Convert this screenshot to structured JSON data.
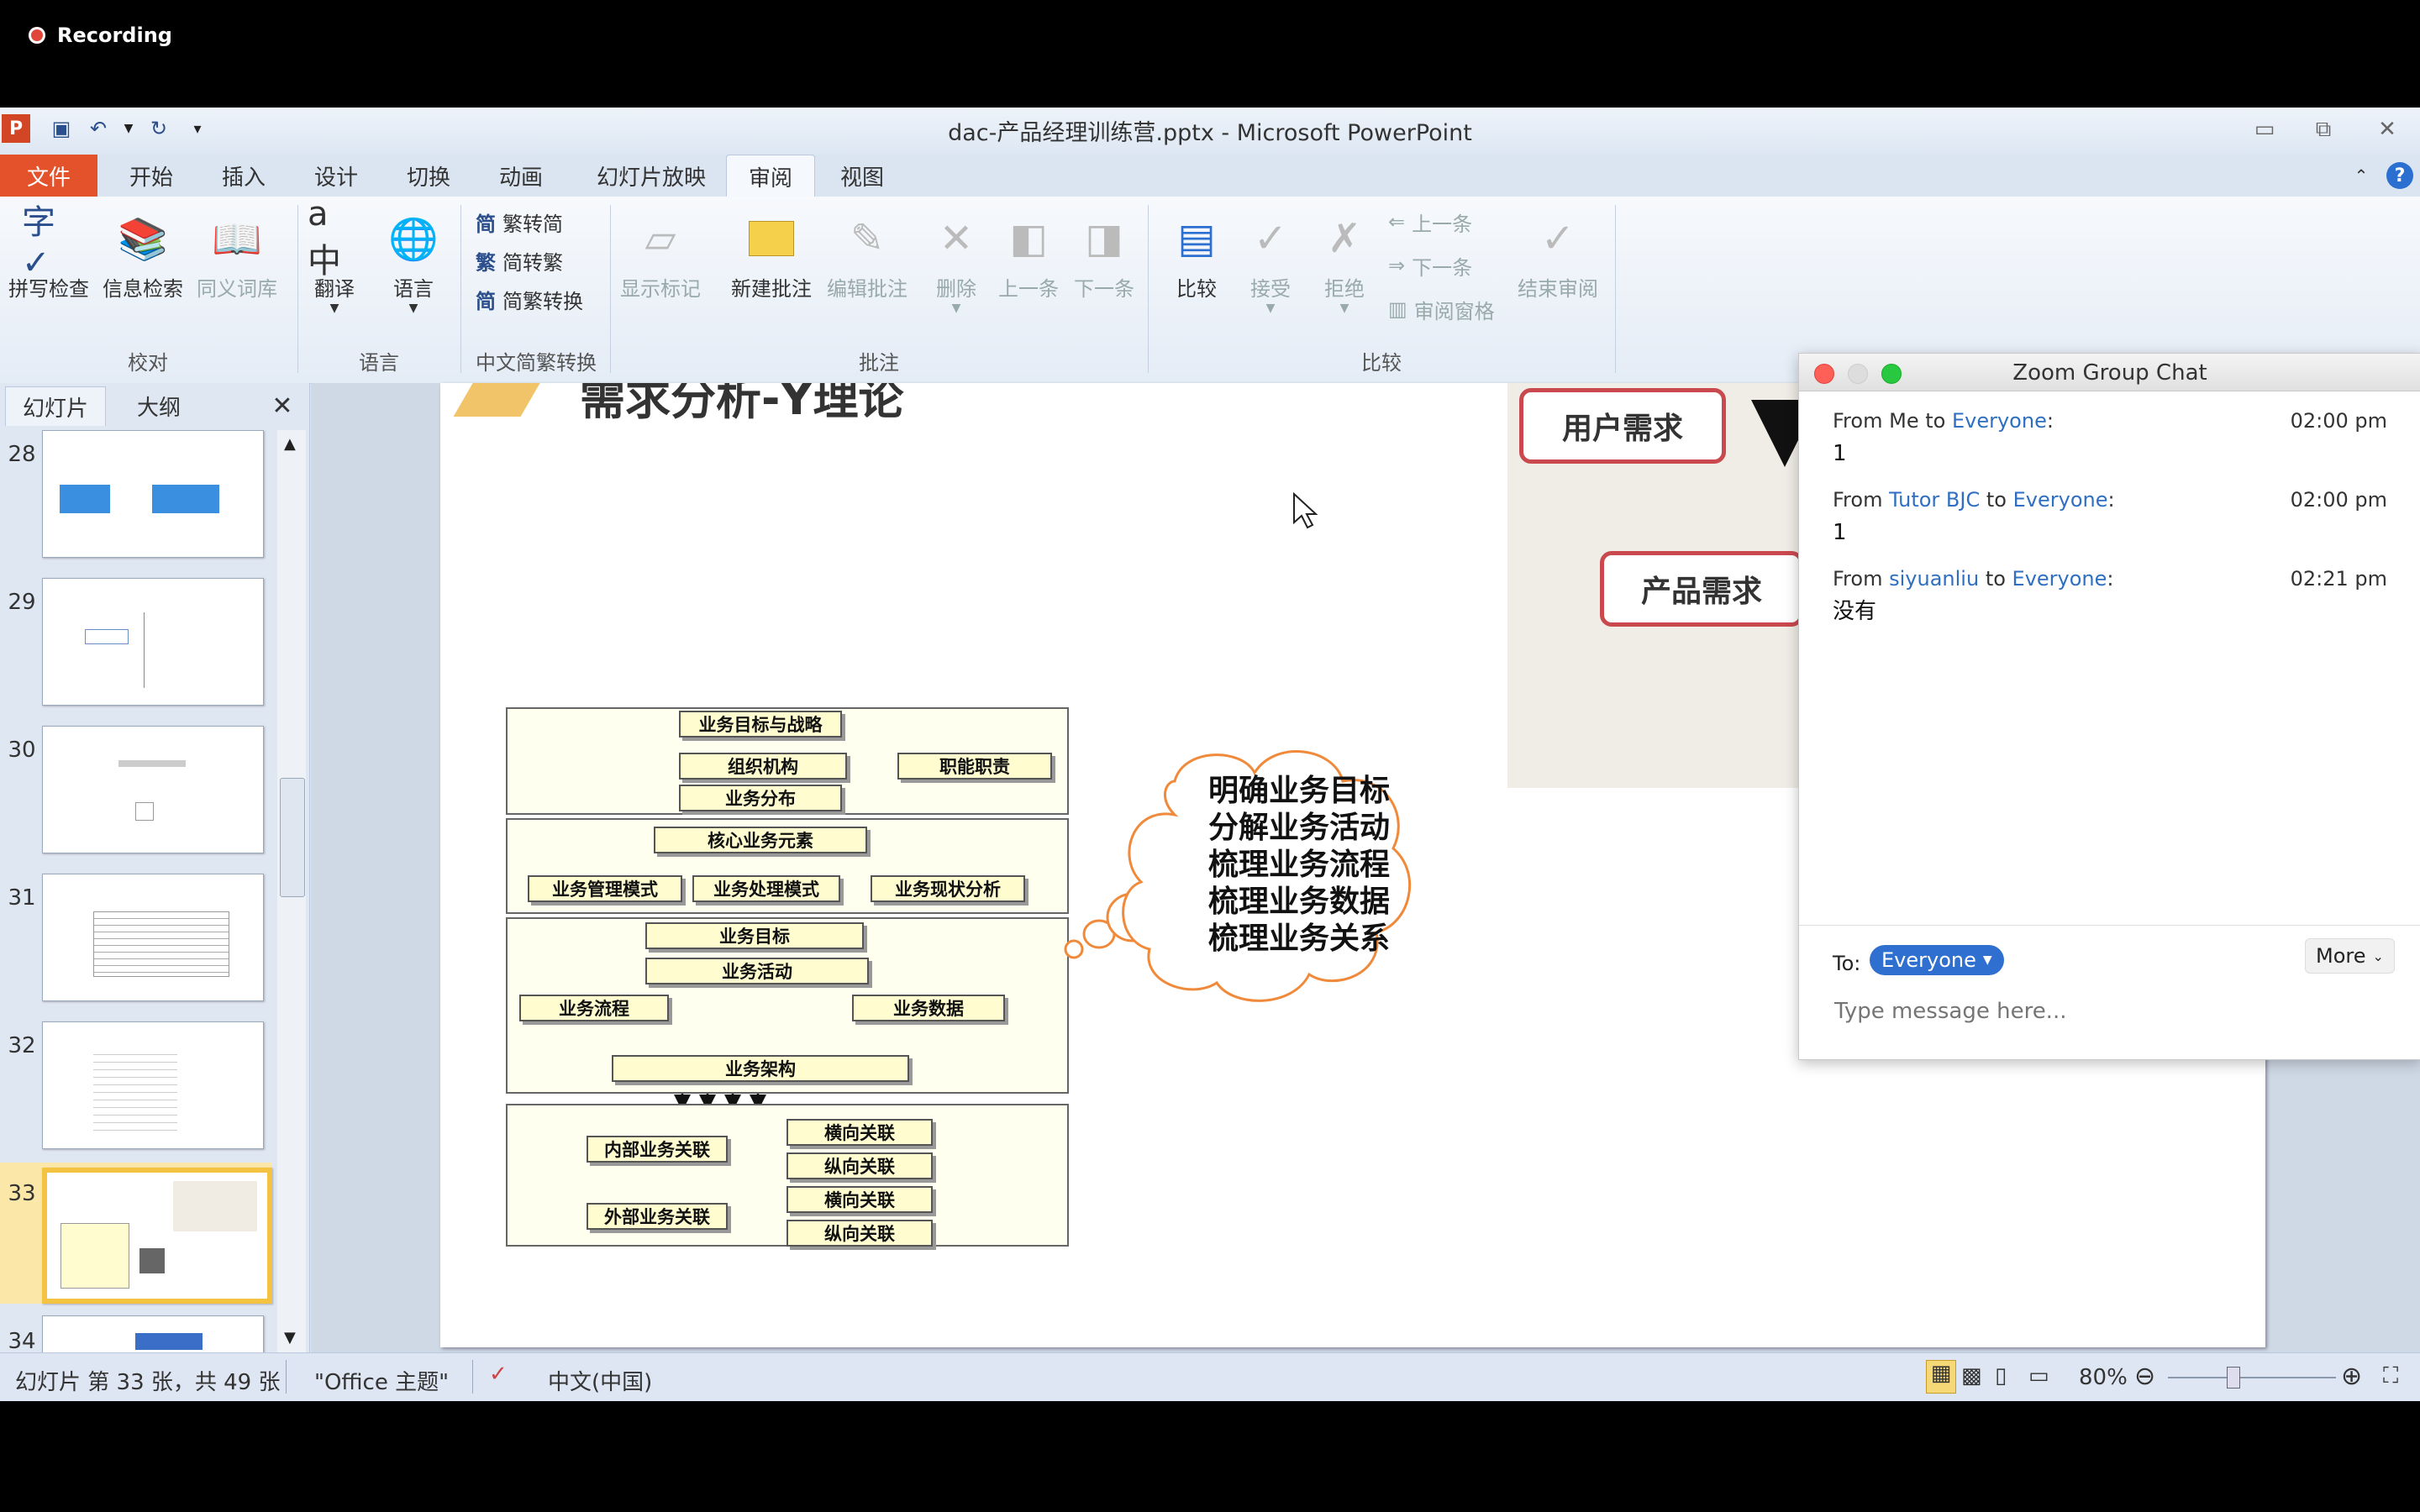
{
  "recording": {
    "label": "Recording"
  },
  "window": {
    "title": "dac-产品经理训练营.pptx - Microsoft PowerPoint",
    "tabs": [
      "文件",
      "开始",
      "插入",
      "设计",
      "切换",
      "动画",
      "幻灯片放映",
      "审阅",
      "视图"
    ],
    "active_tab": "审阅"
  },
  "ribbon": {
    "proofing": {
      "spell": "拼写检查",
      "research": "信息检索",
      "thesaurus": "同义词库",
      "group": "校对"
    },
    "language": {
      "translate": "翻译",
      "language": "语言",
      "group": "语言"
    },
    "chinese": {
      "to_simplified": "繁转简",
      "to_traditional": "简转繁",
      "convert": "简繁转换",
      "group": "中文简繁转换"
    },
    "comments": {
      "show_markup": "显示标记",
      "new": "新建批注",
      "edit": "编辑批注",
      "delete": "删除",
      "prev": "上一条",
      "next": "下一条",
      "group": "批注"
    },
    "compare": {
      "compare": "比较",
      "accept": "接受",
      "reject": "拒绝",
      "prev": "上一条",
      "next": "下一条",
      "pane": "审阅窗格",
      "end": "结束审阅",
      "group": "比较"
    }
  },
  "left_panel": {
    "tabs": [
      "幻灯片",
      "大纲"
    ],
    "slides": [
      "28",
      "29",
      "30",
      "31",
      "32",
      "33",
      "34"
    ],
    "selected": "33"
  },
  "slide": {
    "title": "需求分析-Y理论",
    "user_need": "用户需求",
    "product_need": "产品需求",
    "diagram": {
      "b1": "业务目标与战略",
      "b2": "组织机构",
      "b3": "职能职责",
      "b4": "业务分布",
      "b5": "核心业务元素",
      "b6": "业务管理模式",
      "b7": "业务处理模式",
      "b8": "业务现状分析",
      "b9": "业务目标",
      "b10": "业务活动",
      "b11": "业务流程",
      "b12": "业务数据",
      "b13": "业务架构",
      "b14": "内部业务关联",
      "b15": "外部业务关联",
      "b16": "横向关联",
      "b17": "纵向关联"
    },
    "cloud_lines": [
      "明确业务目标",
      "分解业务活动",
      "梳理业务流程",
      "梳理业务数据",
      "梳理业务关系"
    ]
  },
  "chat": {
    "title": "Zoom Group Chat",
    "messages": [
      {
        "from_word": "From",
        "sender": "Me",
        "to_word": "to",
        "recipient": "Everyone",
        "time": "02:00 pm",
        "text": "1"
      },
      {
        "from_word": "From",
        "sender": "Tutor BJC",
        "to_word": "to",
        "recipient": "Everyone",
        "time": "02:00 pm",
        "text": "1"
      },
      {
        "from_word": "From",
        "sender": "siyuanliu",
        "to_word": "to",
        "recipient": "Everyone",
        "time": "02:21 pm",
        "text": "没有"
      }
    ],
    "to_label": "To:",
    "to_value": "Everyone",
    "more": "More",
    "placeholder": "Type message here..."
  },
  "status": {
    "slide_info": "幻灯片 第 33 张，共 49 张",
    "theme": "\"Office 主题\"",
    "language": "中文(中国)",
    "zoom": "80%"
  },
  "colors": {
    "file_tab": "#e3522a",
    "selected_slide": "#f5c342",
    "link": "#2e6fc2",
    "callout_border": "#c9494f"
  }
}
